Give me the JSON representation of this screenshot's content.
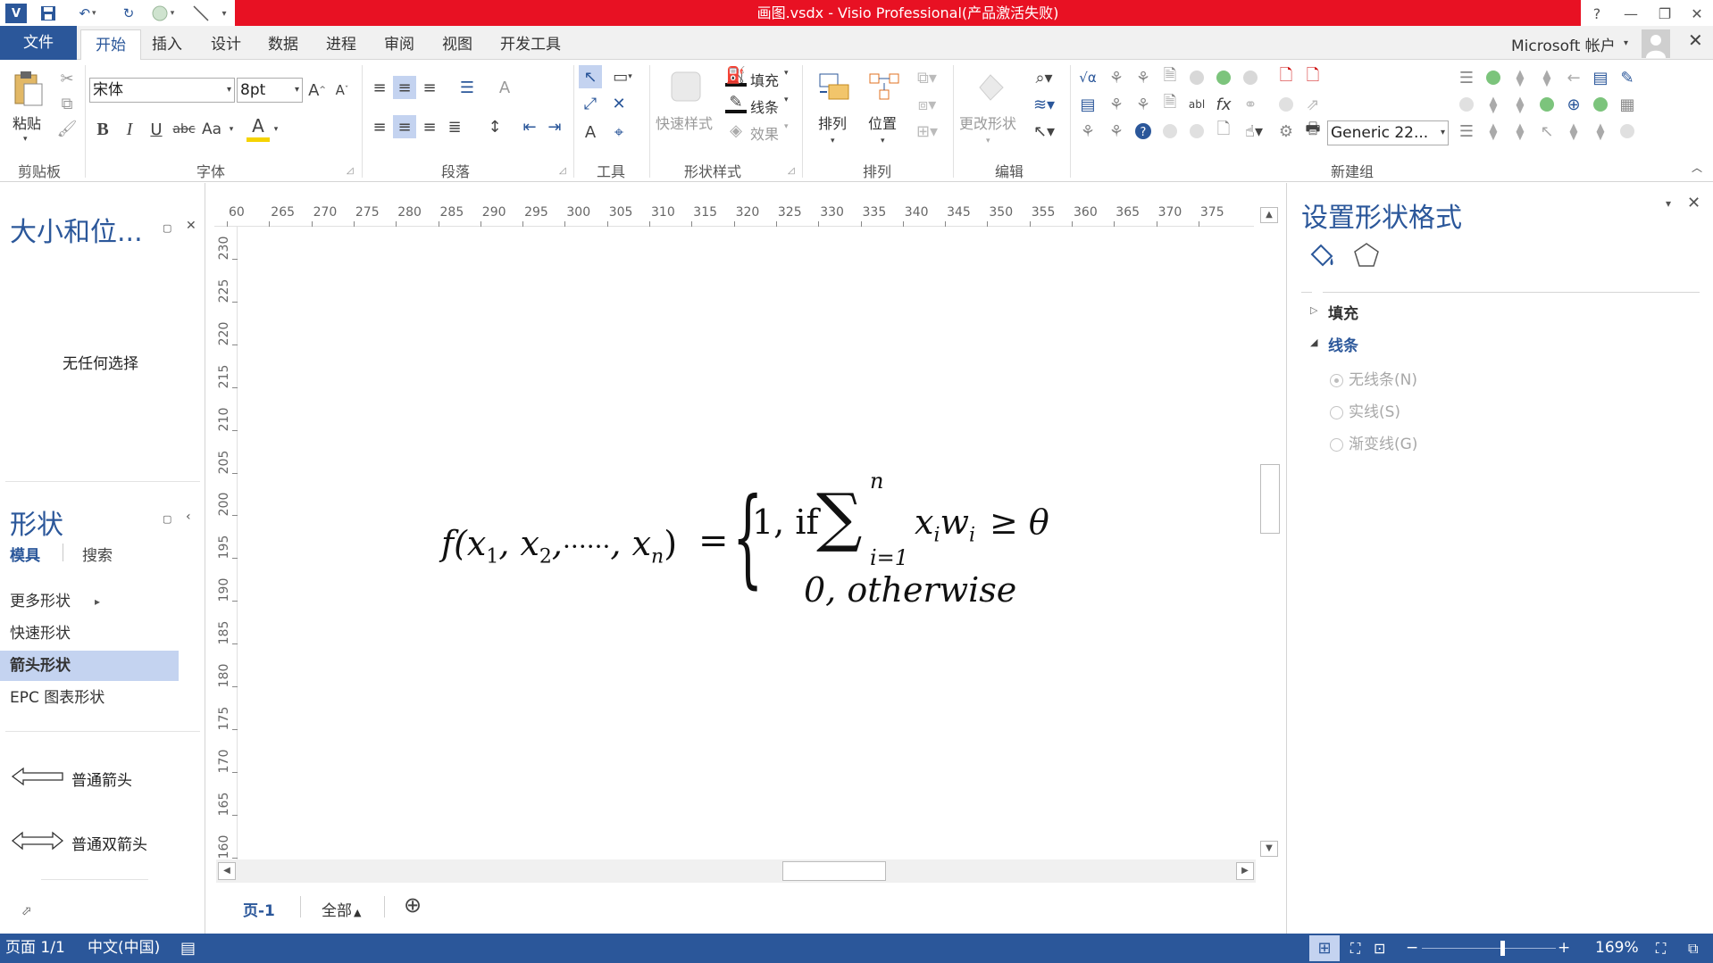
{
  "window": {
    "title": "画图.vsdx -  Visio Professional(产品激活失败)",
    "help": "?",
    "minimize": "—",
    "restore": "❐",
    "close": "✕"
  },
  "account": {
    "label": "Microsoft 帐户",
    "close": "✕"
  },
  "tabs": {
    "file": "文件",
    "items": [
      "开始",
      "插入",
      "设计",
      "数据",
      "进程",
      "审阅",
      "视图",
      "开发工具"
    ],
    "active_index": 0
  },
  "ribbon": {
    "clipboard": {
      "paste": "粘贴",
      "label": "剪贴板"
    },
    "font": {
      "font_name": "宋体",
      "font_size": "8pt",
      "label": "字体",
      "bold": "B",
      "italic": "I",
      "underline": "U",
      "strike": "abc",
      "case": "Aa",
      "color": "A"
    },
    "paragraph": {
      "label": "段落"
    },
    "tools": {
      "label": "工具",
      "text_tool": "A"
    },
    "shape_styles": {
      "quick_styles": "快速样式",
      "fill": "填充",
      "line": "线条",
      "effects": "效果",
      "label": "形状样式"
    },
    "arrange": {
      "arrange": "排列",
      "position": "位置",
      "label": "排列"
    },
    "edit": {
      "change_shape": "更改形状",
      "label": "编辑"
    },
    "new_group": {
      "label": "新建组",
      "combo_value": "Generic 22..."
    }
  },
  "size_position_panel": {
    "title": "大小和位...",
    "empty_text": "无任何选择"
  },
  "shapes_panel": {
    "title": "形状",
    "tab_stencils": "模具",
    "tab_search": "搜索",
    "items": [
      {
        "label": "更多形状"
      },
      {
        "label": "快速形状"
      },
      {
        "label": "箭头形状"
      },
      {
        "label": "EPC 图表形状"
      }
    ],
    "selected_index": 2,
    "shapes": [
      {
        "label": "普通箭头"
      },
      {
        "label": "普通双箭头"
      }
    ]
  },
  "ruler": {
    "h_ticks": [
      "60",
      "265",
      "270",
      "275",
      "280",
      "285",
      "290",
      "295",
      "300",
      "305",
      "310",
      "315",
      "320",
      "325",
      "330",
      "335",
      "340",
      "345",
      "350",
      "355",
      "360",
      "365",
      "370",
      "375"
    ],
    "v_ticks": [
      "230",
      "225",
      "220",
      "215",
      "210",
      "205",
      "200",
      "195",
      "190",
      "185",
      "180",
      "175",
      "170",
      "165",
      "160"
    ]
  },
  "formula": {
    "lhs": "f(x",
    "sub1": "1",
    "sub2": "2",
    "subn": "n",
    "dots": "······",
    "equals": "=",
    "case1_prefix": "1, if",
    "sum_upper": "n",
    "sum_lower": "i=1",
    "case1_term": "x",
    "case1_sub_i": "i",
    "case1_w": "w",
    "case1_geq": "≥ θ",
    "case2": "0, otherwise"
  },
  "page_tabs": {
    "page": "页-1",
    "all": "全部",
    "add": "⊕"
  },
  "format_pane": {
    "title": "设置形状格式",
    "sections": [
      {
        "label": "填充",
        "expanded": false
      },
      {
        "label": "线条",
        "expanded": true
      }
    ],
    "line_options": [
      {
        "label": "无线条(N)",
        "checked": true
      },
      {
        "label": "实线(S)",
        "checked": false
      },
      {
        "label": "渐变线(G)",
        "checked": false
      }
    ]
  },
  "status": {
    "page": "页面 1/1",
    "language": "中文(中国)",
    "zoom": "169%",
    "zoom_minus": "−",
    "zoom_plus": "+"
  },
  "colors": {
    "accent": "#2b579a",
    "title_red": "#e81123",
    "selected_item": "#c4d3f0"
  }
}
